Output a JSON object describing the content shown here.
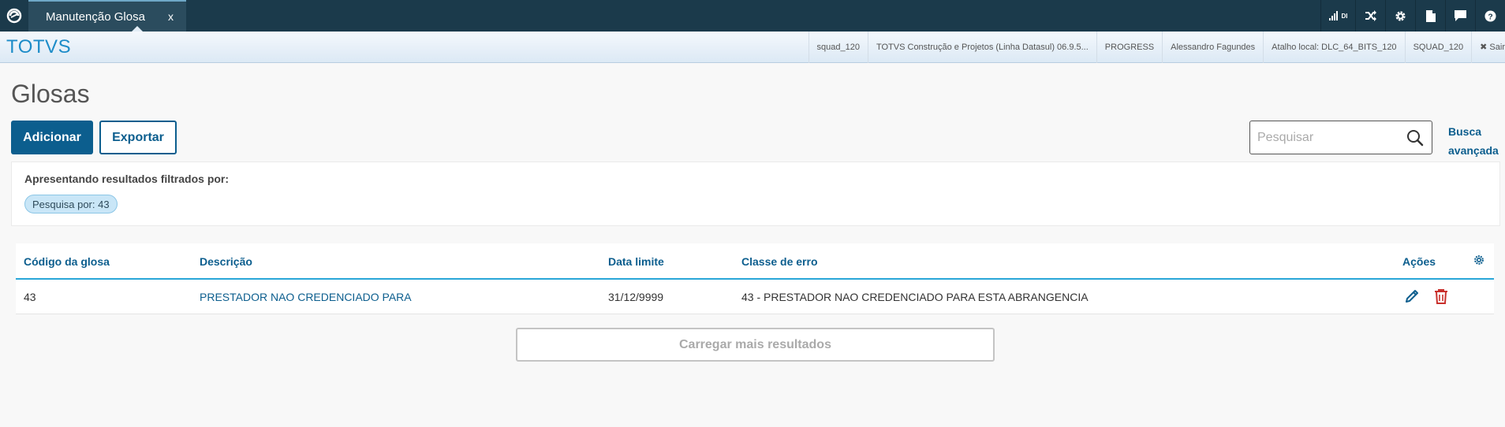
{
  "topbar": {
    "tab_label": "Manutenção Glosa",
    "tab_close": "x",
    "signal_label": "DI"
  },
  "infobar": {
    "brand": "TOTVS",
    "items": [
      "squad_120",
      "TOTVS Construção e Projetos (Linha Datasul) 06.9.5...",
      "PROGRESS",
      "Alessandro Fagundes",
      "Atalho local: DLC_64_BITS_120",
      "SQUAD_120"
    ],
    "logout": "✖ Sair"
  },
  "page": {
    "title": "Glosas",
    "add_button": "Adicionar",
    "export_button": "Exportar",
    "search_placeholder": "Pesquisar",
    "advanced_search": "Busca avançada"
  },
  "filter": {
    "title": "Apresentando resultados filtrados por:",
    "chip": "Pesquisa por: 43"
  },
  "table": {
    "headers": {
      "code": "Código da glosa",
      "description": "Descrição",
      "deadline": "Data limite",
      "error_class": "Classe de erro",
      "actions": "Ações"
    },
    "rows": [
      {
        "code": "43",
        "description": "PRESTADOR NAO CREDENCIADO PARA",
        "deadline": "31/12/9999",
        "error_class": "43 - PRESTADOR NAO CREDENCIADO PARA ESTA ABRANGENCIA"
      }
    ],
    "load_more": "Carregar mais resultados"
  },
  "colors": {
    "topbar": "#1b3a4b",
    "brand": "#1d8cc8",
    "primary": "#0c5e8e",
    "delete": "#c9302c",
    "table_accent": "#29a6d8"
  },
  "icons": [
    "totvs-logo-icon",
    "signal-icon",
    "shuffle-icon",
    "gear-icon",
    "document-icon",
    "chat-icon",
    "help-icon",
    "search-icon",
    "edit-icon",
    "trash-icon",
    "column-settings-icon"
  ]
}
